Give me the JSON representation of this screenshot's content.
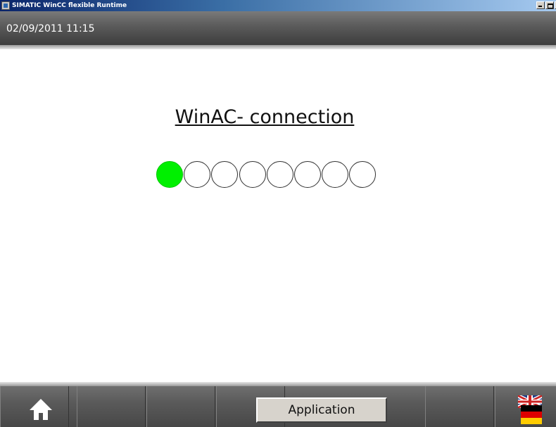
{
  "window": {
    "title": "SIMATIC WinCC flexible Runtime"
  },
  "header": {
    "datetime": "02/09/2011 11:15"
  },
  "main": {
    "title": "WinAC- connection",
    "indicators": [
      {
        "state": "on"
      },
      {
        "state": "off"
      },
      {
        "state": "off"
      },
      {
        "state": "off"
      },
      {
        "state": "off"
      },
      {
        "state": "off"
      },
      {
        "state": "off"
      },
      {
        "state": "off"
      }
    ]
  },
  "footer": {
    "home_icon": "home-icon",
    "application_label": "Application",
    "language_icon": "uk-germany-flag-icon"
  },
  "colors": {
    "indicator_on": "#00f000",
    "indicator_off": "#ffffff",
    "header_bg": "#5d5d5d",
    "footer_bg": "#5a5a5a"
  }
}
